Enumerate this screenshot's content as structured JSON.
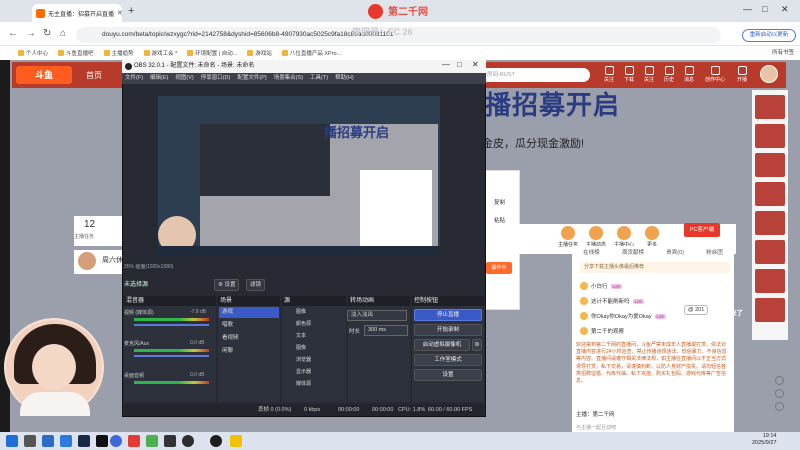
{
  "browser": {
    "tab_title": "无主直播：招募开启直播",
    "new_tab": "+",
    "url": "douyu.com/beta/topic/wzxygc?rid=2142758&dyshid=85606b8-4907930ac5025c9fa18c85ab00031101",
    "update_label": "重新启动以更新",
    "all_bookmarks": "所有书签",
    "bookmarks": [
      "个人中心",
      "斗鱼直播吧",
      "主播趋势",
      "游戏工会 *",
      "环境配置 | 自动...",
      "游戏站",
      "八位直播产品 XPro..."
    ],
    "window_controls": [
      "—",
      "□",
      "✕"
    ]
  },
  "watermark": {
    "brand": "第二千网",
    "room_label": "房间号：FC 26"
  },
  "douyu": {
    "logo": "斗鱼",
    "home": "首页",
    "search_placeholder": "搜索房间-RUST",
    "header_icons": [
      "关注",
      "下载",
      "关注",
      "历史",
      "消息",
      "创作中心",
      "开播"
    ],
    "banner_title": "播招募开启",
    "banner_sub": "金皮，瓜分现金激励!",
    "stat_num": "12",
    "stat_label": "主播任务",
    "anchor_name": "周六休",
    "pc_button": "PC客户端",
    "gifts": [
      "主播任务",
      "主播动态",
      "主播中心",
      "更多"
    ],
    "dialog_rows": [
      "复制",
      "粘贴"
    ],
    "dialog_button": "操作中"
  },
  "chat": {
    "tabs": [
      "在线榜",
      "周贡献榜",
      "贵宾(0)",
      "粉丝团"
    ],
    "sub_notice": "分享下载主播头像最后推荐",
    "rank": [
      {
        "name": "小白行",
        "badge": "Lv8"
      },
      {
        "name": "这计不能刷新吗",
        "badge": "Lv6"
      },
      {
        "name": "你Okay你Okay为爱Okay",
        "badge": "Lv6"
      },
      {
        "name": "第二千的观察",
        "badge": ""
      }
    ],
    "body": "欢迎来到第二千网的直播间，斗鱼严禁未成年人直播或打赏。依法对直播内容进行24小时巡查，禁止传播违规违法、低俗暴力、不良信息等内容。直播间请遵守相关法律法规，如主播在直播间以不正当方式诱导打赏，私下交易，请谨慎判断，以防人身财产损失。请勿轻信各类招聘征婚、代练代抽、私下充值、购买礼包码、游戏代练等广告信息。",
    "host_label": "主播：",
    "host_name": "第二千网",
    "input_placeholder": "与主播一起互动吧",
    "float_user": "@ 201",
    "float_text": "来了"
  },
  "obs": {
    "title": "OBS 32.0.1 - 配置文件: 未命名 - 场景: 未命名",
    "menu": [
      "文件(F)",
      "编辑(E)",
      "视图(V)",
      "停靠窗口(D)",
      "配置文件(P)",
      "场景集合(S)",
      "工具(T)",
      "帮助(H)"
    ],
    "preview_status": "35%  画面(1920x1080)",
    "source_none": "未选择源",
    "settings_btn": "⚙ 设置",
    "filters_btn": "滤镜",
    "dock_titles": [
      "混音器",
      "场景",
      "源",
      "转场动画",
      "控制按钮"
    ],
    "mixer": [
      {
        "name": "视频 (媒体源)",
        "value": "-7.8 dB"
      },
      {
        "name": "麦克风/Aux",
        "value": "0.0 dB"
      },
      {
        "name": "桌面音频",
        "value": "0.0 dB"
      }
    ],
    "scenes": [
      "游戏",
      "唱歌",
      "看视频",
      "闲聊"
    ],
    "sources": [
      "图像",
      "颜色源",
      "文本",
      "图像",
      "浏览器",
      "显示器",
      "媒体源"
    ],
    "transition": "淡入淡出",
    "duration_label": "时长",
    "duration_value": "300 ms",
    "controls": [
      "停止直播",
      "开始录制",
      "启动虚拟摄像机",
      "工作室模式",
      "设置"
    ],
    "bottom": {
      "frames": "丢帧 0 (0.0%)",
      "kbps": "0 kbps",
      "rec_time": "00:00:00",
      "live_time": "00:00:00",
      "cpu": "CPU: 1.8%",
      "fps": "60.00 / 60.00 FPS"
    }
  },
  "taskbar": {
    "time": "19:14",
    "date": "2025/9/27"
  },
  "colors": {
    "douyu_red": "#b73a2b",
    "obs_accent": "#3a5bc7",
    "brand_orange": "#ff6a00"
  }
}
